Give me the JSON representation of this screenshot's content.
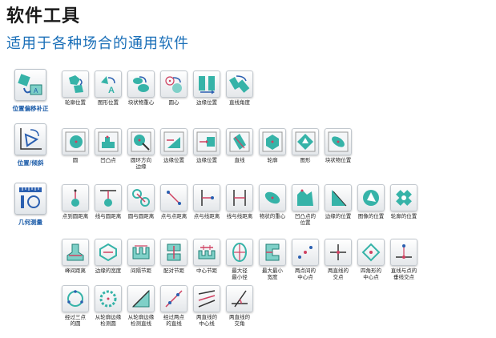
{
  "title": "软件工具",
  "subtitle": "适用于各种场合的通用软件",
  "colors": {
    "accent": "#1a6fb8",
    "icon_fill": "#36b3a8",
    "icon_arrow": "#2a5fb0",
    "icon_stroke": "#333333"
  },
  "categories": [
    {
      "label": "位置偏移补正",
      "icon": "position-offset-icon",
      "tools": [
        {
          "label": "轮廓位置",
          "icon": "contour-position-icon"
        },
        {
          "label": "图形位置",
          "icon": "pattern-position-icon"
        },
        {
          "label": "块状物重心",
          "icon": "blob-centroid-icon"
        },
        {
          "label": "圆心",
          "icon": "circle-center-icon"
        },
        {
          "label": "边缘位置",
          "icon": "edge-position-icon"
        },
        {
          "label": "直线角度",
          "icon": "line-angle-icon"
        }
      ]
    },
    {
      "label": "位置/倾斜",
      "icon": "position-tilt-icon",
      "tools": [
        {
          "label": "圆",
          "icon": "circle-icon"
        },
        {
          "label": "凹凸点",
          "icon": "bump-point-icon"
        },
        {
          "label": "圆环方向\n边缘",
          "icon": "ring-direction-edge-icon"
        },
        {
          "label": "边缘位置",
          "icon": "edge-position-icon"
        },
        {
          "label": "边缘位置",
          "icon": "edge-position-icon"
        },
        {
          "label": "直线",
          "icon": "straight-line-icon"
        },
        {
          "label": "轮廓",
          "icon": "contour-icon"
        },
        {
          "label": "图形",
          "icon": "pattern-icon"
        },
        {
          "label": "块状物位置",
          "icon": "blob-position-icon"
        }
      ]
    },
    {
      "label": "几何测量",
      "icon": "geometry-measure-icon",
      "tools": [
        {
          "label": "点到圆距离",
          "icon": "point-circle-distance-icon"
        },
        {
          "label": "线与圆距离",
          "icon": "line-circle-distance-icon"
        },
        {
          "label": "圆与圆距离",
          "icon": "circle-circle-distance-icon"
        },
        {
          "label": "点与点距离",
          "icon": "point-point-distance-icon"
        },
        {
          "label": "点与线距离",
          "icon": "point-line-distance-icon"
        },
        {
          "label": "线与线距离",
          "icon": "line-line-distance-icon"
        },
        {
          "label": "物状的重心",
          "icon": "object-centroid-icon"
        },
        {
          "label": "凹凸点的\n位置",
          "icon": "bump-position-icon"
        },
        {
          "label": "边缘的位置",
          "icon": "edge-location-icon"
        },
        {
          "label": "图像的位置",
          "icon": "image-position-icon"
        },
        {
          "label": "轮廓的位置",
          "icon": "contour-location-icon"
        },
        {
          "label": "峰间距离",
          "icon": "peak-distance-icon"
        },
        {
          "label": "边缘的宽度",
          "icon": "edge-width-icon"
        },
        {
          "label": "间隔节距",
          "icon": "interval-pitch-icon"
        },
        {
          "label": "配对节距",
          "icon": "paired-pitch-icon"
        },
        {
          "label": "中心节距",
          "icon": "center-pitch-icon"
        },
        {
          "label": "最大径\n最小径",
          "icon": "max-min-diameter-icon"
        },
        {
          "label": "最大最小\n宽度",
          "icon": "max-min-width-icon"
        },
        {
          "label": "两点间的\n中心点",
          "icon": "two-point-midpoint-icon"
        },
        {
          "label": "两直线的\n交点",
          "icon": "line-intersection-icon"
        },
        {
          "label": "四角形的\n中心点",
          "icon": "quad-center-icon"
        },
        {
          "label": "直线与点的\n垂线交点",
          "icon": "perpendicular-foot-icon"
        },
        {
          "label": "经过三点\n的圆",
          "icon": "three-point-circle-icon"
        },
        {
          "label": "从轮廓边缘\n检测圆",
          "icon": "contour-circle-detect-icon"
        },
        {
          "label": "从轮廓边缘\n检测直线",
          "icon": "contour-line-detect-icon"
        },
        {
          "label": "经过两点\n的直线",
          "icon": "two-point-line-icon"
        },
        {
          "label": "两直线的\n中心线",
          "icon": "center-line-icon"
        },
        {
          "label": "两直线的\n交角",
          "icon": "line-angle-intersect-icon"
        }
      ]
    }
  ]
}
